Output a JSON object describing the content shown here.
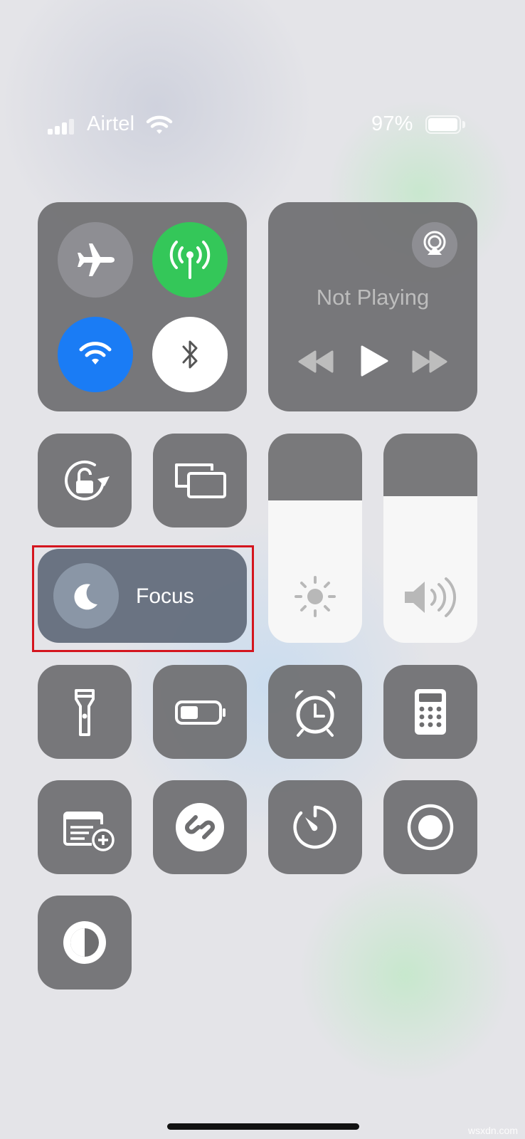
{
  "status_bar": {
    "carrier": "Airtel",
    "battery_percent": "97%",
    "battery_level": 0.97
  },
  "connectivity": {
    "airplane_mode": {
      "icon": "airplane-icon",
      "active": false,
      "color": "#8e8e93"
    },
    "cellular_data": {
      "icon": "antenna-icon",
      "active": true,
      "color": "#34c759"
    },
    "wifi": {
      "icon": "wifi-icon",
      "active": true,
      "color": "#1a7cf5"
    },
    "bluetooth": {
      "icon": "bluetooth-icon",
      "active": false,
      "color": "#ffffff"
    }
  },
  "now_playing": {
    "title": "Not Playing",
    "airplay_icon": "airplay-icon",
    "controls": [
      "rewind-icon",
      "play-icon",
      "fast-forward-icon"
    ]
  },
  "controls": {
    "orientation_lock": {
      "icon": "rotation-lock-icon"
    },
    "screen_mirroring": {
      "icon": "screen-mirroring-icon"
    },
    "focus": {
      "label": "Focus",
      "icon": "moon-icon"
    },
    "brightness": {
      "icon": "sun-icon",
      "level": 0.68
    },
    "volume": {
      "icon": "speaker-icon",
      "level": 0.7
    }
  },
  "toggle_grid": [
    {
      "name": "flashlight",
      "icon": "flashlight-icon"
    },
    {
      "name": "low-power-mode",
      "icon": "battery-icon"
    },
    {
      "name": "alarm",
      "icon": "alarm-clock-icon"
    },
    {
      "name": "calculator",
      "icon": "calculator-icon"
    },
    {
      "name": "quick-note",
      "icon": "quick-note-icon"
    },
    {
      "name": "shazam",
      "icon": "shazam-icon"
    },
    {
      "name": "timer",
      "icon": "timer-icon"
    },
    {
      "name": "screen-recording",
      "icon": "record-icon"
    },
    {
      "name": "dark-mode",
      "icon": "dark-mode-icon"
    }
  ],
  "colors": {
    "tile": "#6e6e70",
    "highlight": "#d4151e"
  },
  "watermark": "wsxdn.com"
}
